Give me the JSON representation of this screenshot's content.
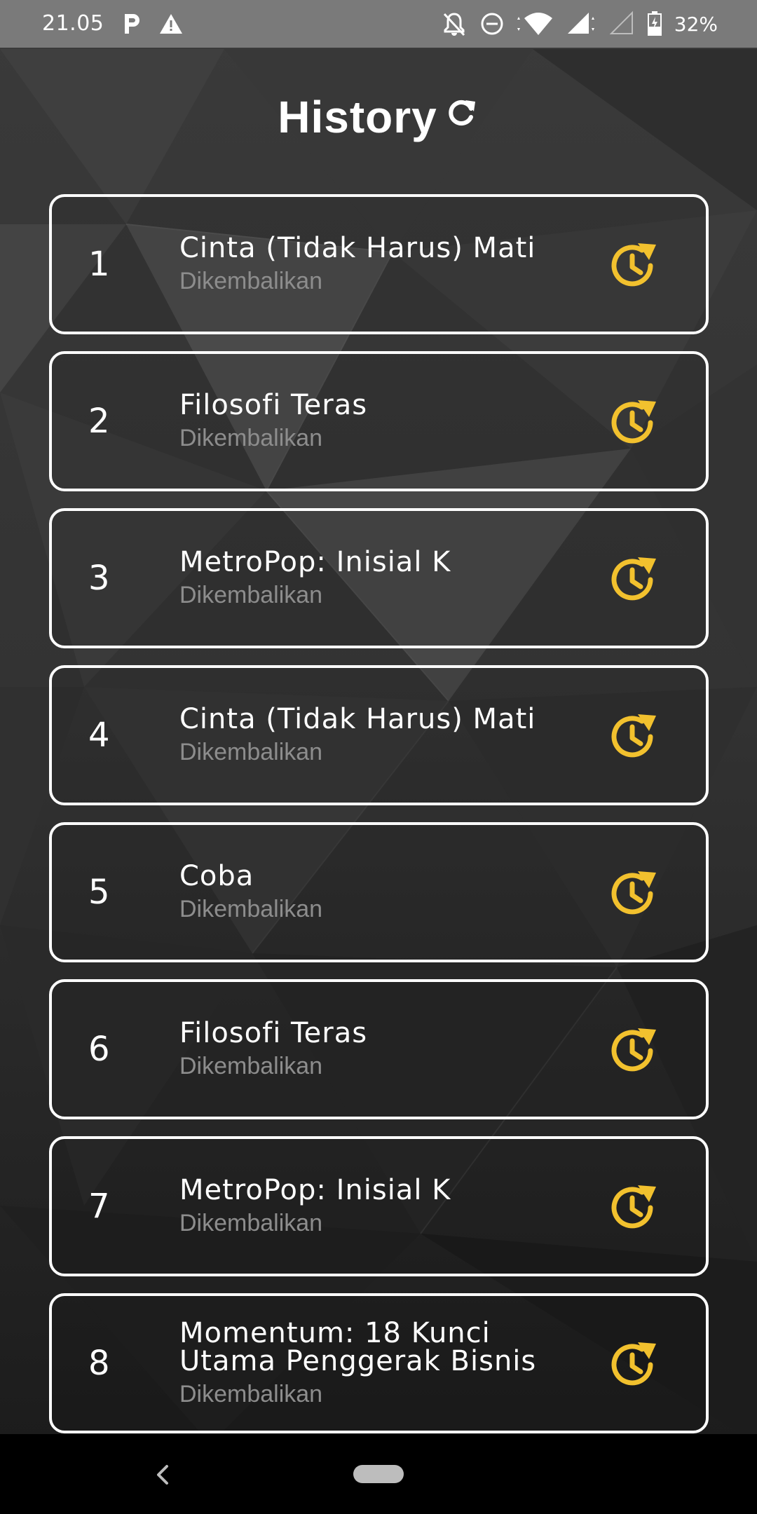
{
  "statusbar": {
    "time": "21.05",
    "battery": "32%",
    "icons": [
      "parking-icon",
      "warning-icon",
      "notifications-off-icon",
      "do-not-disturb-icon",
      "wifi-icon",
      "signal-icon",
      "signal-empty-icon",
      "battery-icon"
    ]
  },
  "header": {
    "title": "History",
    "refresh_icon": "refresh-icon"
  },
  "colors": {
    "accent": "#F2C12E",
    "text": "#FFFFFF",
    "muted": "#8D8D8D",
    "statusbar": "#7A7A7A",
    "navbar": "#000000"
  },
  "history": {
    "items": [
      {
        "number": "1",
        "title": "Cinta (Tidak Harus) Mati",
        "status": "Dikembalikan"
      },
      {
        "number": "2",
        "title": "Filosofi Teras",
        "status": "Dikembalikan"
      },
      {
        "number": "3",
        "title": "MetroPop: Inisial K",
        "status": "Dikembalikan"
      },
      {
        "number": "4",
        "title": "Cinta (Tidak Harus) Mati",
        "status": "Dikembalikan"
      },
      {
        "number": "5",
        "title": "Coba",
        "status": "Dikembalikan"
      },
      {
        "number": "6",
        "title": "Filosofi Teras",
        "status": "Dikembalikan"
      },
      {
        "number": "7",
        "title": "MetroPop: Inisial K",
        "status": "Dikembalikan"
      },
      {
        "number": "8",
        "title_lines": [
          "Momentum: 18 Kunci",
          "Utama Penggerak Bisnis"
        ],
        "status": "Dikembalikan"
      }
    ],
    "action_icon": "history-clock-icon"
  },
  "navbar": {
    "back_icon": "back-icon",
    "home_icon": "home-pill-icon"
  }
}
